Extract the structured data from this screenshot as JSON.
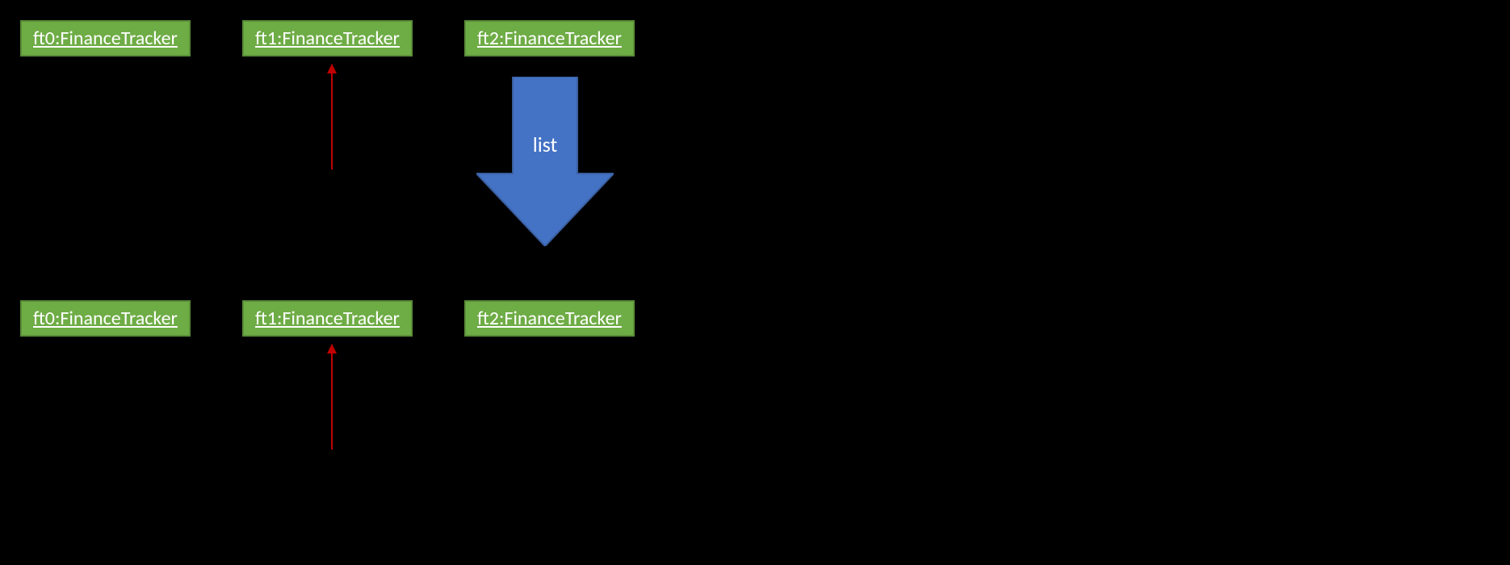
{
  "objects": {
    "top_row": [
      {
        "label": "ft0:FinanceTracker"
      },
      {
        "label": "ft1:FinanceTracker"
      },
      {
        "label": "ft2:FinanceTracker"
      }
    ],
    "bottom_row": [
      {
        "label": "ft0:FinanceTracker"
      },
      {
        "label": "ft1:FinanceTracker"
      },
      {
        "label": "ft2:FinanceTracker"
      }
    ]
  },
  "arrow_label": "list",
  "colors": {
    "box_fill": "#6eac45",
    "box_border": "#5a8d38",
    "red_arrow": "#c00000",
    "big_arrow": "#4472c4"
  }
}
